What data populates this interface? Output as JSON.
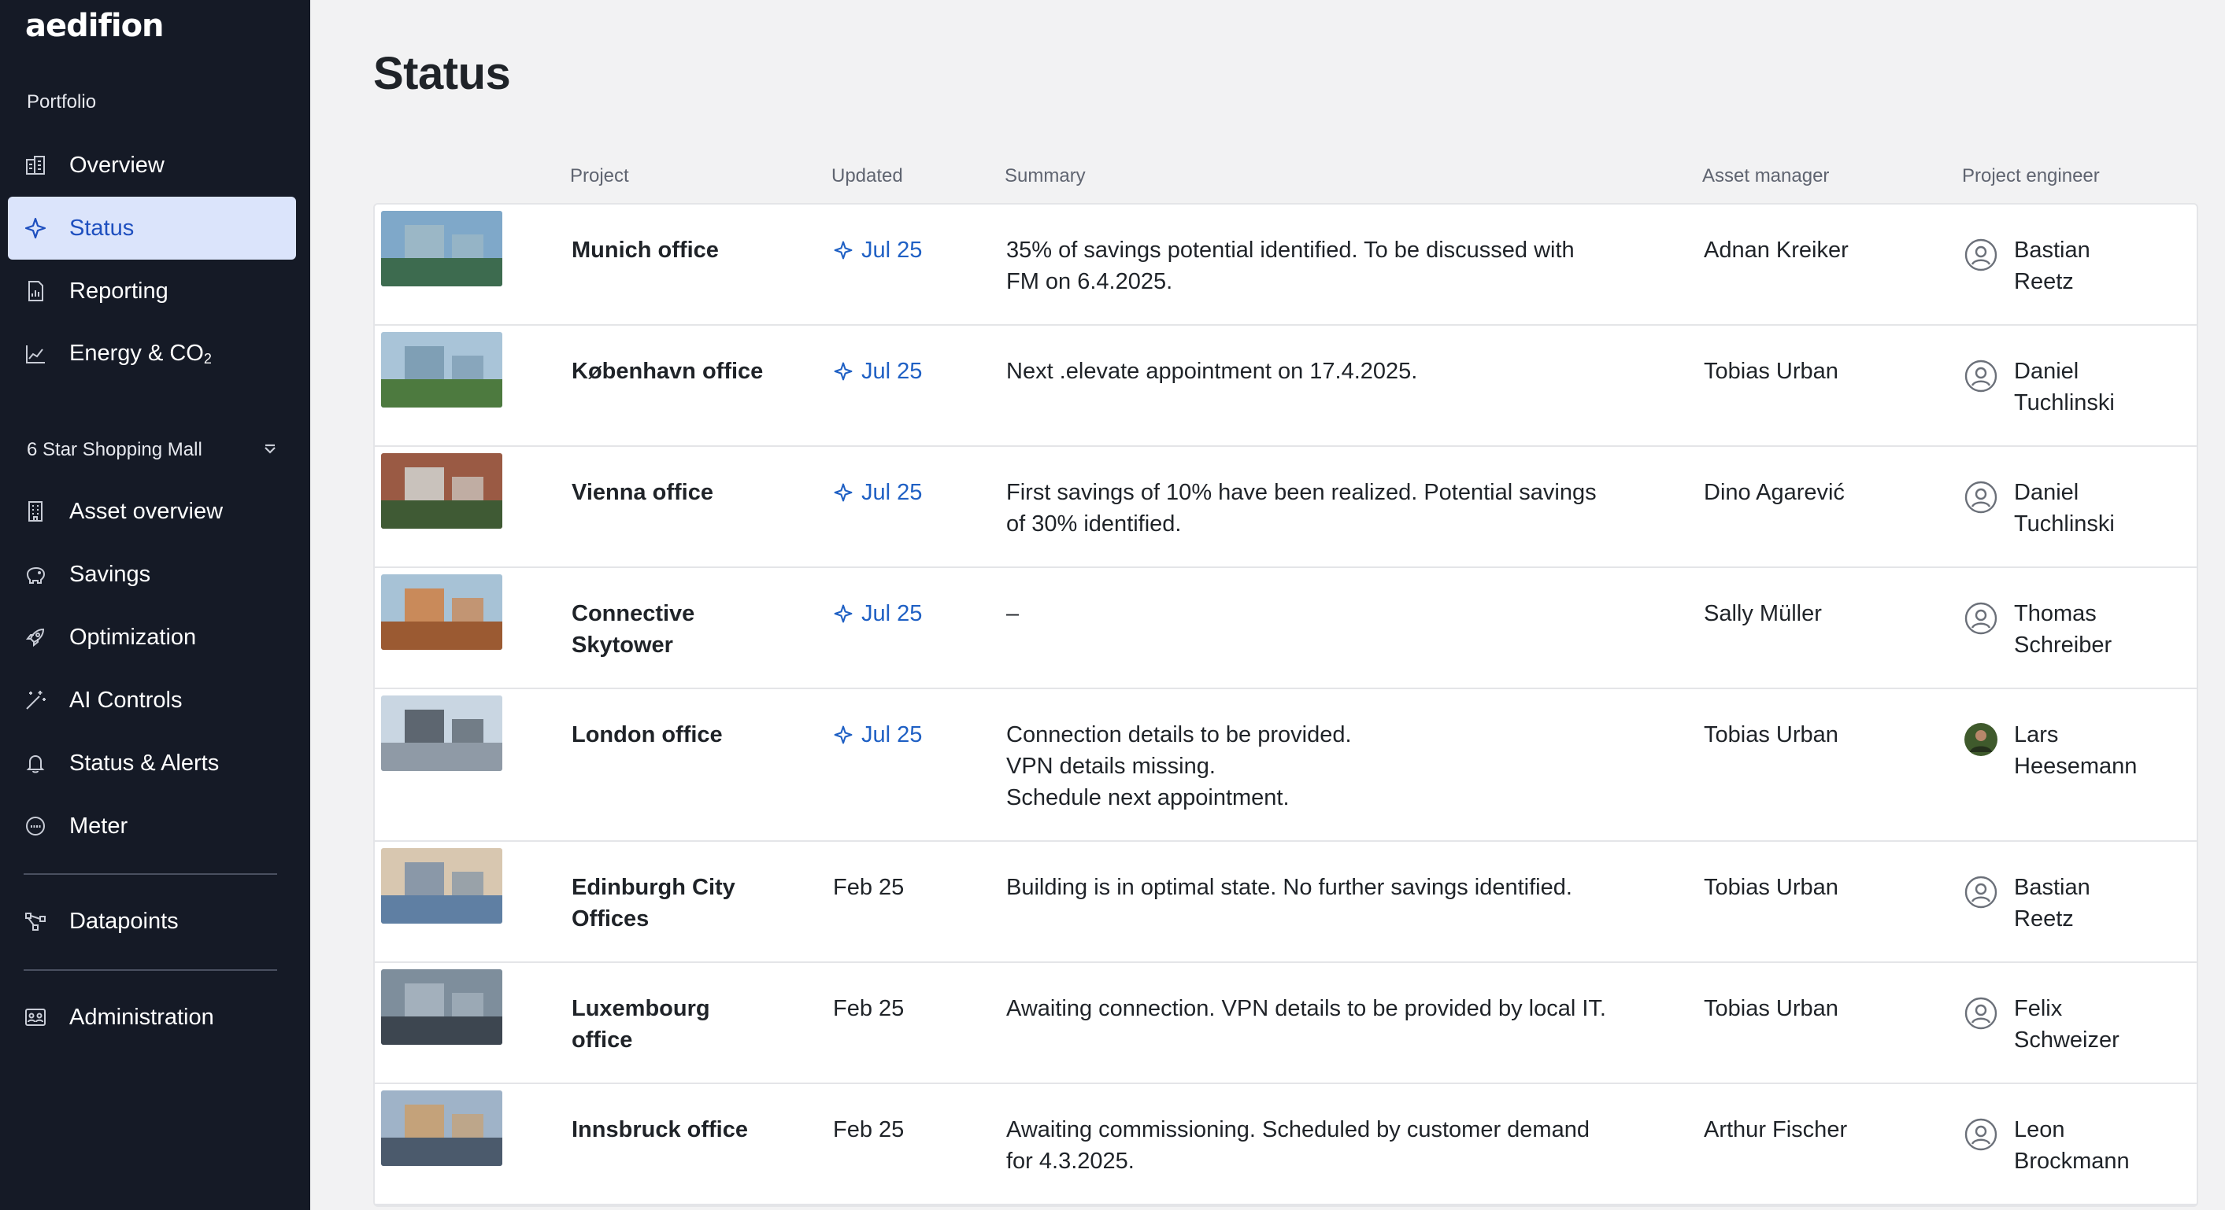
{
  "sidebar": {
    "logo": "aedifion",
    "portfolio_label": "Portfolio",
    "portfolio_items": [
      {
        "label": "Overview",
        "icon": "building-icon"
      },
      {
        "label": "Status",
        "icon": "sparkle-icon",
        "active": true
      },
      {
        "label": "Reporting",
        "icon": "report-icon"
      },
      {
        "label": "Energy & CO",
        "label_sub": "2",
        "icon": "chart-icon"
      }
    ],
    "asset_select": "6 Star Shopping Mall",
    "asset_items": [
      {
        "label": "Asset overview",
        "icon": "asset-icon"
      },
      {
        "label": "Savings",
        "icon": "piggy-bank-icon"
      },
      {
        "label": "Optimization",
        "icon": "rocket-icon"
      },
      {
        "label": "AI Controls",
        "icon": "magic-wand-icon"
      },
      {
        "label": "Status & Alerts",
        "icon": "bell-icon"
      },
      {
        "label": "Meter",
        "icon": "gauge-icon"
      }
    ],
    "datapoints_label": "Datapoints",
    "administration_label": "Administration",
    "colors": {
      "background": "#151a26",
      "active_bg": "#dbe4fb",
      "active_text": "#1e4fbf"
    }
  },
  "page": {
    "title": "Status"
  },
  "table": {
    "headers": {
      "project": "Project",
      "updated": "Updated",
      "summary": "Summary",
      "asset_manager": "Asset manager",
      "project_engineer": "Project engineer"
    },
    "rows": [
      {
        "project": "Munich office",
        "updated": "Jul 25",
        "recent": true,
        "summary": "35% of savings potential identified. To be discussed with\nFM on 6.4.2025.",
        "manager": "Adnan Kreiker",
        "engineer": "Bastian\nReetz",
        "avatar": "user-icon"
      },
      {
        "project": "København office",
        "updated": "Jul 25",
        "recent": true,
        "summary": "Next .elevate appointment on 17.4.2025.",
        "manager": "Tobias Urban",
        "engineer": "Daniel\nTuchlinski",
        "avatar": "user-icon"
      },
      {
        "project": "Vienna office",
        "updated": "Jul 25",
        "recent": true,
        "summary": "First savings of 10% have been realized. Potential savings\nof 30% identified.",
        "manager": "Dino Agarević",
        "engineer": "Daniel\nTuchlinski",
        "avatar": "user-icon"
      },
      {
        "project": "Connective\nSkytower",
        "updated": "Jul 25",
        "recent": true,
        "summary": "–",
        "manager": "Sally Müller",
        "engineer": "Thomas\nSchreiber",
        "avatar": "user-icon"
      },
      {
        "project": "London office",
        "updated": "Jul 25",
        "recent": true,
        "summary": "Connection details to be provided.\nVPN details missing.\nSchedule next appointment.",
        "manager": "Tobias Urban",
        "engineer": "Lars\nHeesemann",
        "avatar": "photo-avatar",
        "tall": true
      },
      {
        "project": "Edinburgh City\nOffices",
        "updated": "Feb 25",
        "recent": false,
        "summary": "Building is in optimal state. No further savings identified.",
        "manager": "Tobias Urban",
        "engineer": "Bastian\nReetz",
        "avatar": "user-icon"
      },
      {
        "project": "Luxembourg\noffice",
        "updated": "Feb 25",
        "recent": false,
        "summary": "Awaiting connection. VPN details to be provided by local IT.",
        "manager": "Tobias Urban",
        "engineer": "Felix\nSchweizer",
        "avatar": "user-icon"
      },
      {
        "project": "Innsbruck office",
        "updated": "Feb 25",
        "recent": false,
        "summary": "Awaiting commissioning. Scheduled by customer demand\nfor 4.3.2025.",
        "manager": "Arthur Fischer",
        "engineer": "Leon\nBrockmann",
        "avatar": "user-icon"
      }
    ],
    "colors": {
      "recent": "#1f60c4",
      "row_bg": "#ffffff",
      "border": "#e4e5e8"
    }
  }
}
